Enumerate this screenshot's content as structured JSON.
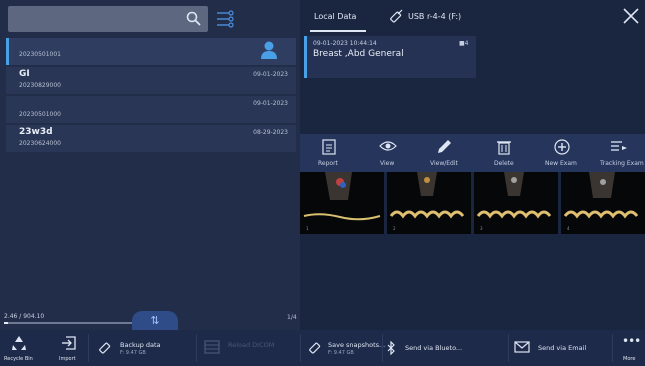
{
  "search": {
    "value": ""
  },
  "patients": [
    {
      "name": "",
      "id": "20230501001",
      "date": "",
      "selected": true,
      "has_avatar": true
    },
    {
      "name": "GI",
      "id": "20230829000",
      "date": "09-01-2023",
      "selected": false
    },
    {
      "name": "",
      "id": "20230501000",
      "date": "09-01-2023",
      "selected": false
    },
    {
      "name": "23w3d",
      "id": "20230624000",
      "date": "08-29-2023",
      "selected": false
    }
  ],
  "storage": {
    "text": "2.46 / 904.10",
    "fraction": 0.003
  },
  "page_count": "1/4",
  "tabs": {
    "local": "Local Data",
    "usb": "USB r-4-4 (F:)"
  },
  "exam": {
    "date": "09-01-2023 10:44:14",
    "title": "Breast ,Abd General",
    "count": "4"
  },
  "toolbar": {
    "report": "Report",
    "view": "View",
    "view_edit": "View/Edit",
    "delete": "Delete",
    "new_exam": "New Exam",
    "tracking": "Tracking Exam"
  },
  "thumb_labels": [
    "1",
    "2",
    "3",
    "4"
  ],
  "bottom": {
    "recycle": "Recycle Bin",
    "import": "Import",
    "backup": "Backup data",
    "backup_sub": "F: 9.47 GB",
    "reload": "Reload DICOM",
    "reload_sub": "",
    "snapshots": "Save snapshots...",
    "snapshots_sub": "F: 9.47 GB",
    "bluetooth": "Send via Blueto...",
    "email": "Send via Email",
    "more": "More"
  },
  "colors": {
    "accent": "#4aa0e6",
    "panel": "#222d4a",
    "bg": "#1a2540"
  }
}
